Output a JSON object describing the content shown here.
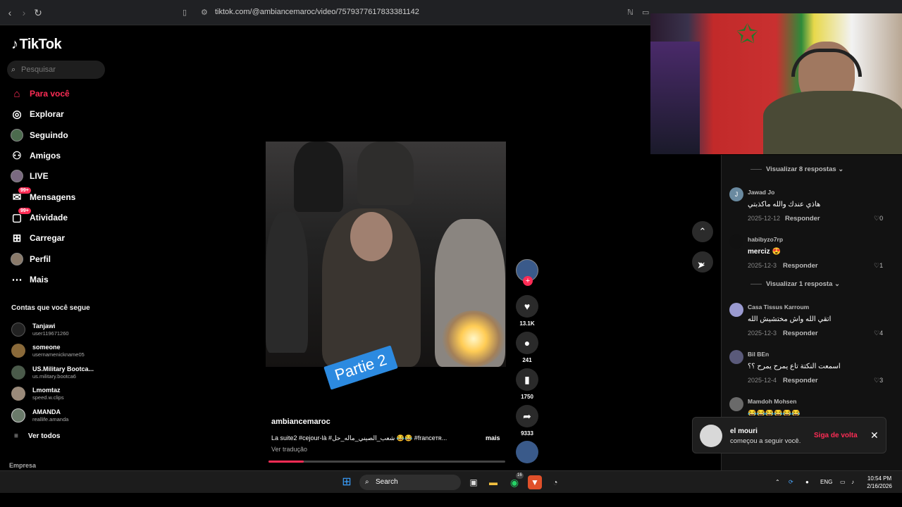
{
  "browser": {
    "url": "tiktok.com/@ambiancemaroc/video/7579377617833381142"
  },
  "sidebar": {
    "logo": "TikTok",
    "search_placeholder": "Pesquisar",
    "nav": [
      {
        "label": "Para você",
        "icon": "home-icon",
        "active": true
      },
      {
        "label": "Explorar",
        "icon": "compass-icon"
      },
      {
        "label": "Seguindo",
        "icon": "following-avatar-icon"
      },
      {
        "label": "Amigos",
        "icon": "friends-icon"
      },
      {
        "label": "LIVE",
        "icon": "live-icon"
      },
      {
        "label": "Mensagens",
        "icon": "messages-icon",
        "badge": "99+"
      },
      {
        "label": "Atividade",
        "icon": "activity-icon",
        "badge": "99+"
      },
      {
        "label": "Carregar",
        "icon": "upload-icon"
      },
      {
        "label": "Perfil",
        "icon": "profile-icon"
      },
      {
        "label": "Mais",
        "icon": "more-icon"
      }
    ],
    "following_title": "Contas que você segue",
    "following": [
      {
        "name": "Tanjawi",
        "user": "user119671260"
      },
      {
        "name": "someone",
        "user": "usernamenickname05"
      },
      {
        "name": "US.Military Bootca...",
        "user": "us.military.bootca6"
      },
      {
        "name": "Lmomtaz",
        "user": "speed.w.clips"
      },
      {
        "name": "AMANDA",
        "user": "reallife.amanda"
      }
    ],
    "see_all": "Ver todos",
    "footer": "Empresa"
  },
  "video": {
    "sticker": "Partie 2",
    "author": "ambiancemaroc",
    "caption": "La suite2 #cejour-là #شعب_الصيني_ماله_حل 😂😂 #franceᴛʀ...",
    "more": "mais",
    "translate": "Ver tradução",
    "progress": 0.15,
    "likes": "13.1K",
    "comments": "241",
    "saves": "1750",
    "shares": "9333"
  },
  "comments": {
    "view_replies_8": "Visualizar 8 respostas",
    "view_replies_1": "Visualizar 1 resposta",
    "reply_label": "Responder",
    "items": [
      {
        "initial": "J",
        "user": "Jawad Jo",
        "text": "هاذي عندك والله ماكذبتي",
        "date": "2025-12-12",
        "likes": "0"
      },
      {
        "initial": "",
        "user": "habibyzo7rp",
        "text": "merciz 😍",
        "date": "2025-12-3",
        "likes": "1"
      },
      {
        "initial": "",
        "user": "Casa Tissus Karroum",
        "text": "اتقي الله واش مختشيش الله",
        "date": "2025-12-3",
        "likes": "4"
      },
      {
        "initial": "",
        "user": "Bil BEn",
        "text": "اسمعت النكتة تاع يمرح يمرح ؟؟",
        "date": "2025-12-4",
        "likes": "3"
      },
      {
        "initial": "",
        "user": "Mamdoh Mohsen",
        "text": "😂😂😂😂😂😂",
        "date": "",
        "likes": ""
      }
    ]
  },
  "toast": {
    "name": "el mouri",
    "message": "começou a seguir você.",
    "action": "Siga de volta"
  },
  "taskbar": {
    "search": "Search",
    "lang": "ENG",
    "time": "10:54 PM",
    "date": "2/16/2026",
    "whatsapp_badge": "16"
  }
}
